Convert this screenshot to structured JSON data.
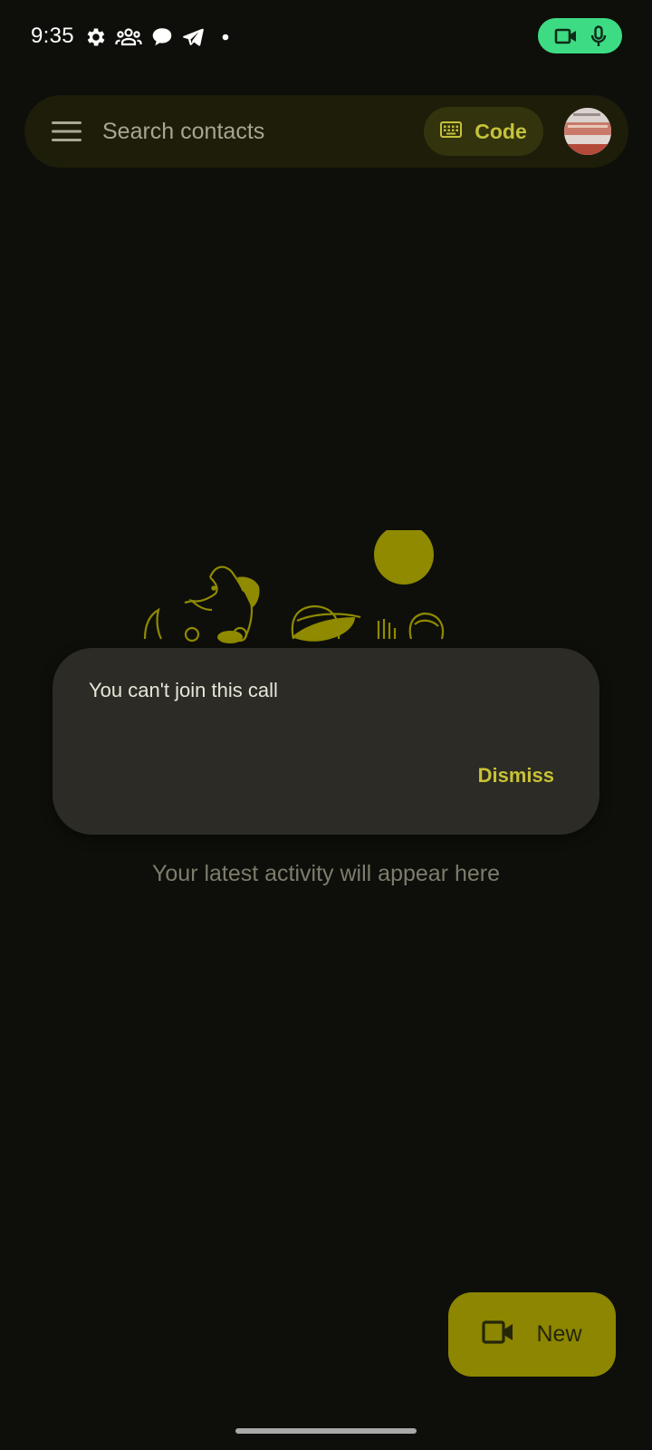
{
  "status_bar": {
    "time": "9:35",
    "icons": [
      "gear-icon",
      "people-icon",
      "chat-bubble-icon",
      "telegram-icon",
      "dot-icon"
    ],
    "call_chip_icons": [
      "video-camera-icon",
      "microphone-icon"
    ],
    "call_chip_color": "#3ddc84"
  },
  "search_bar": {
    "placeholder": "Search contacts",
    "code_button_label": "Code",
    "icons": [
      "menu-icon",
      "keyboard-icon",
      "avatar"
    ]
  },
  "empty_state": {
    "message": "Your latest activity will appear here"
  },
  "snackbar": {
    "message": "You can't join this call",
    "action_label": "Dismiss"
  },
  "fab": {
    "label": "New",
    "icon": "video-camera-icon"
  },
  "colors": {
    "background": "#0e0f0a",
    "accent": "#c8c235",
    "fab": "#8c8600",
    "illustration": "#8f8a00"
  }
}
